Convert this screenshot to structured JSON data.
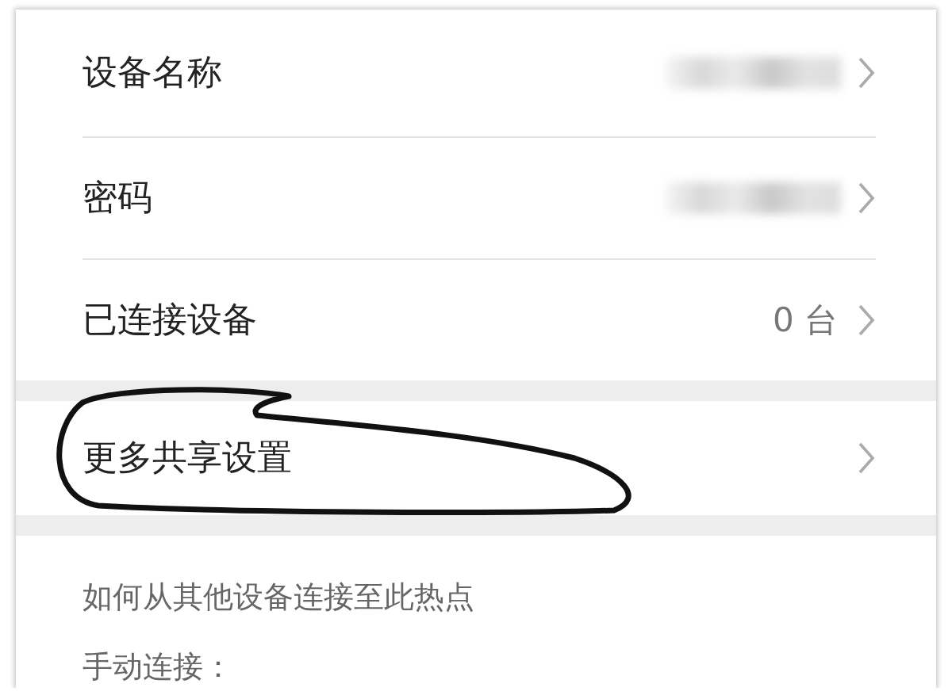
{
  "rows": [
    {
      "label": "设备名称",
      "kind": "blurred"
    },
    {
      "label": "密码",
      "kind": "blurred"
    },
    {
      "label": "已连接设备",
      "kind": "value",
      "value": "0 台"
    }
  ],
  "more_row": {
    "label": "更多共享设置",
    "circled": true
  },
  "help": {
    "title": "如何从其他设备连接至此热点",
    "step": "手动连接："
  }
}
